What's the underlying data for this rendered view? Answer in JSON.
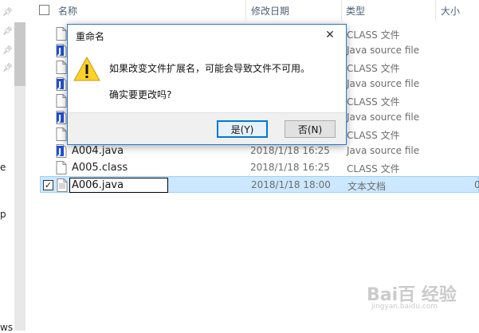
{
  "nav_fragments": [
    "e",
    "p",
    "ws"
  ],
  "header": {
    "name_col": "名称",
    "date_col": "修改日期",
    "type_col": "类型",
    "size_col": "大小"
  },
  "files": [
    {
      "name": "",
      "date": "",
      "type": "CLASS 文件",
      "icon": "class-file-icon"
    },
    {
      "name": "",
      "date": "",
      "type": "Java source file",
      "icon": "java-file-icon"
    },
    {
      "name": "",
      "date": "",
      "type": "CLASS 文件",
      "icon": "class-file-icon"
    },
    {
      "name": "",
      "date": "",
      "type": "Java source file",
      "icon": "java-file-icon"
    },
    {
      "name": "",
      "date": "",
      "type": "CLASS 文件",
      "icon": "class-file-icon"
    },
    {
      "name": "",
      "date": "",
      "type": "Java source file",
      "icon": "java-file-icon"
    },
    {
      "name": "",
      "date": "",
      "type": "CLASS 文件",
      "icon": "class-file-icon"
    },
    {
      "name": "A004.java",
      "date": "2018/1/18 16:25",
      "type": "Java source file",
      "icon": "java-file-icon"
    },
    {
      "name": "A005.class",
      "date": "2018/1/18 16:25",
      "type": "CLASS 文件",
      "icon": "class-file-icon"
    }
  ],
  "selected_file": {
    "name": "A006.java",
    "date": "2018/1/18 18:00",
    "type": "文本文档",
    "size": "0",
    "checked": "✓"
  },
  "dialog": {
    "title": "重命名",
    "close": "✕",
    "message": "如果改变文件扩展名，可能会导致文件不可用。",
    "question": "确实要更改吗?",
    "yes_label": "是(Y)",
    "no_label": "否(N)"
  },
  "watermark": {
    "text": "Bai百 经验",
    "sub": "jingyan.baidu.com"
  },
  "colors": {
    "selection": "#cce8ff",
    "dialog_border": "#2b79d0",
    "default_button_border": "#0078d7",
    "java_icon": "#1f4fd1"
  }
}
